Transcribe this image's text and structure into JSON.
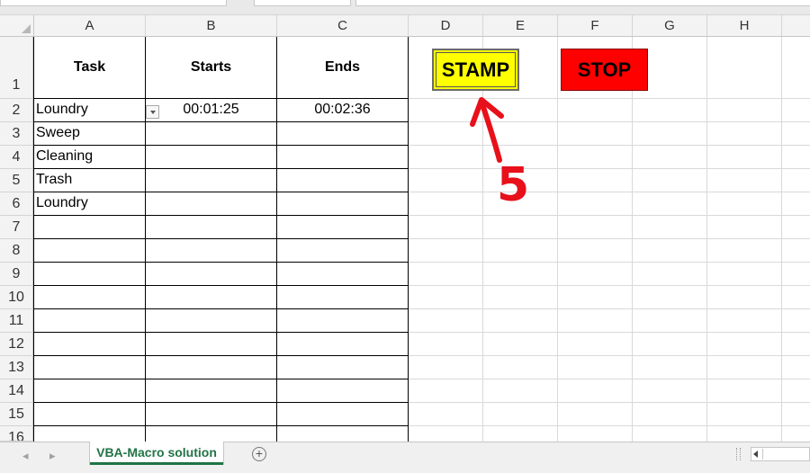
{
  "columns": [
    "A",
    "B",
    "C",
    "D",
    "E",
    "F",
    "G",
    "H"
  ],
  "rows": [
    "1",
    "2",
    "3",
    "4",
    "5",
    "6",
    "7",
    "8",
    "9",
    "10",
    "11",
    "12",
    "13",
    "14",
    "15",
    "16"
  ],
  "table": {
    "headers": {
      "task": "Task",
      "starts": "Starts",
      "ends": "Ends"
    },
    "data": [
      {
        "task": "Loundry",
        "starts": "00:01:25",
        "ends": "00:02:36"
      },
      {
        "task": "Sweep",
        "starts": "",
        "ends": ""
      },
      {
        "task": "Cleaning",
        "starts": "",
        "ends": ""
      },
      {
        "task": "Trash",
        "starts": "",
        "ends": ""
      },
      {
        "task": "Loundry",
        "starts": "",
        "ends": ""
      }
    ]
  },
  "buttons": {
    "stamp": {
      "label": "STAMP",
      "color": "#ffff00"
    },
    "stop": {
      "label": "STOP",
      "color": "#ff0000"
    }
  },
  "annotation": {
    "text": "5",
    "color": "#e8101a"
  },
  "sheet_tabs": [
    {
      "label": "VBA-Macro solution",
      "active": true
    }
  ],
  "icons": {
    "add_sheet": "plus-circle-icon",
    "scroll_left": "caret-left-icon"
  },
  "accent_color": "#217346"
}
